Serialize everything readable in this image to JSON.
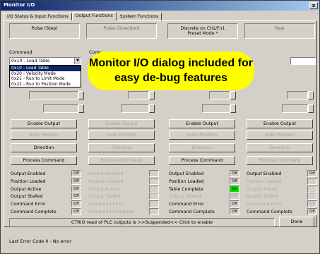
{
  "window": {
    "title": "Monitor I/O",
    "close_glyph": "x"
  },
  "tabs": [
    "I/O Status & Input Functions",
    "Output Functions",
    "System Functions"
  ],
  "columns": [
    {
      "header": "Pulse (Step)",
      "enabled": true
    },
    {
      "header": "Pulse (Direction)",
      "enabled": false
    },
    {
      "header": "Discrete on Ch1/Fn1\nPreset Mode *",
      "enabled": true
    },
    {
      "header": "Raw",
      "enabled": false
    }
  ],
  "command": {
    "label": "Command",
    "label_partial": "Comr",
    "selected": "0x10 - Load Table",
    "options": [
      "0x10 - Load Table",
      "0x20 - Velocity Mode",
      "0x21 - Run to Limit Mode",
      "0x22 - Run to Position Mode"
    ]
  },
  "buttons": {
    "enable_output": "Enable Output",
    "goto_position": "Goto Position",
    "direction": "Direction",
    "process_command": "Process Command"
  },
  "status": {
    "col1": [
      {
        "label": "Output Enabled",
        "value": "Off"
      },
      {
        "label": "Position Loaded",
        "value": "Off"
      },
      {
        "label": "Output Active",
        "value": "Off"
      },
      {
        "label": "Output Stalled",
        "value": "Off"
      },
      {
        "label": "Command Error",
        "value": "Off"
      },
      {
        "label": "Command Complete",
        "value": "Off"
      }
    ],
    "col2": [
      {
        "label": "Output Enabled",
        "value": ""
      },
      {
        "label": "Position Loaded",
        "value": ""
      },
      {
        "label": "Output Active",
        "value": ""
      },
      {
        "label": "Output Stalled",
        "value": ""
      },
      {
        "label": "Command Error",
        "value": ""
      },
      {
        "label": "Command Complete",
        "value": ""
      }
    ],
    "col3": [
      {
        "label": "Output Enabled",
        "value": "Off"
      },
      {
        "label": "Position Loaded",
        "value": "Off"
      },
      {
        "label": "Table Complete",
        "value": "On"
      },
      {
        "label": "Output Stalled",
        "value": "Off"
      },
      {
        "label": "Command Error",
        "value": "Off"
      },
      {
        "label": "Command Complete",
        "value": "Off"
      }
    ],
    "col4": [
      {
        "label": "Output Enabled",
        "value": "Off"
      },
      {
        "label": "Position Loaded",
        "value": ""
      },
      {
        "label": "Output Active",
        "value": ""
      },
      {
        "label": "Output Stalled",
        "value": ""
      },
      {
        "label": "Command Error",
        "value": "Off"
      },
      {
        "label": "Command Complete",
        "value": "Off"
      }
    ]
  },
  "status_bar": "CTRIO read of PLC outputs is >>Suspended<< Click to enable",
  "done_label": "Done",
  "last_error": "Last Error Code   0 - No error",
  "callout": {
    "line1": "Monitor I/O dialog included for",
    "line2": "easy de-bug features"
  },
  "colors": {
    "title_start": "#0a246a",
    "title_end": "#a6caf0",
    "dialog_bg": "#d4d0c8",
    "callout": "#ffff00",
    "on_indicator": "#00e000"
  }
}
